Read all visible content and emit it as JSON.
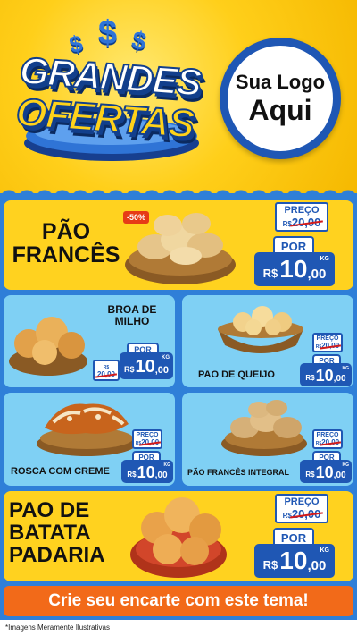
{
  "hero": {
    "word1": "GRANDES",
    "word2": "OFERTAS",
    "dollar_glyph": "$",
    "logo_line1": "Sua Logo",
    "logo_line2": "Aqui"
  },
  "labels": {
    "preco": "PREÇO",
    "por": "POR",
    "currency": "R$",
    "kg": "KG"
  },
  "products": [
    {
      "name_line1": "PÃO",
      "name_line2": "FRANCÊS",
      "name_line3": "",
      "badge": "-50%",
      "old_price": "20,00",
      "price_int": "10",
      "price_cents": ",00",
      "image": "bread-basket-pao-frances"
    },
    {
      "name_line1": "BROA DE",
      "name_line2": "MILHO",
      "name_line3": "",
      "old_price": "20,00",
      "price_int": "10",
      "price_cents": ",00",
      "image": "broa-de-milho-basket"
    },
    {
      "name_line1": "PAO DE QUEIJO",
      "old_price": "20,00",
      "price_int": "10",
      "price_cents": ",00",
      "image": "pao-de-queijo-basket"
    },
    {
      "name_line1": "ROSCA COM CREME",
      "old_price": "20,00",
      "price_int": "10",
      "price_cents": ",00",
      "image": "rosca-com-creme-basket"
    },
    {
      "name_line1": "PÃO FRANCÊS INTEGRAL",
      "old_price": "20,00",
      "price_int": "10",
      "price_cents": ",00",
      "image": "pao-frances-integral-basket"
    },
    {
      "name_line1": "PAO DE",
      "name_line2": "BATATA",
      "name_line3": "PADARIA",
      "old_price": "20,00",
      "price_int": "10",
      "price_cents": ",00",
      "image": "pao-de-batata-bowl"
    }
  ],
  "cta": "Crie seu encarte com este tema!",
  "footer": "*Imagens Meramente Ilustrativas",
  "colors": {
    "brand_blue": "#1f57b4",
    "yellow": "#ffd21f",
    "sky": "#7fd0f4",
    "cta_orange": "#f26a19",
    "strike_red": "#d21b1b"
  }
}
